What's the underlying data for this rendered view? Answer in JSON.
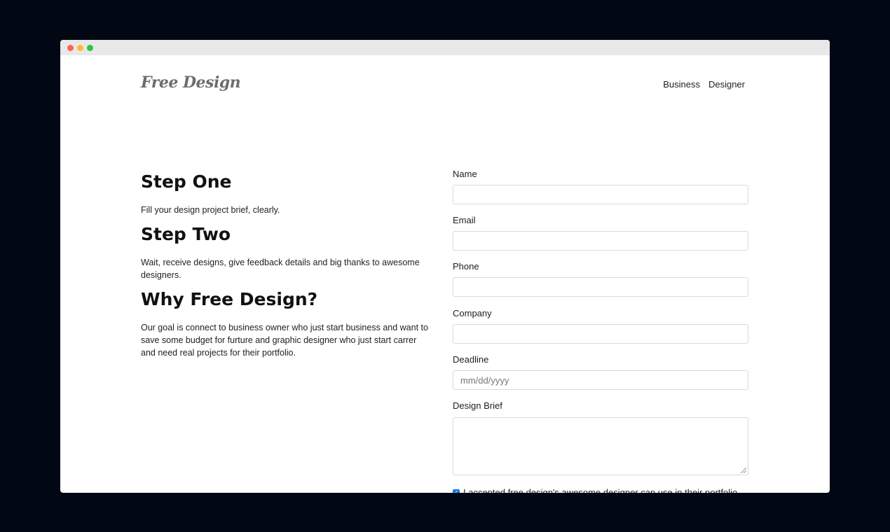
{
  "header": {
    "logo": "Free Design",
    "nav": [
      "Business",
      "Designer"
    ]
  },
  "steps": {
    "step_one_title": "Step One",
    "step_one_text": "Fill your design project brief, clearly.",
    "step_two_title": "Step Two",
    "step_two_text": "Wait, receive designs, give feedback details and big thanks to awesome designers.",
    "why_title": "Why Free Design?",
    "why_text": "Our goal is connect to business owner who just start business and want to save some budget for furture and graphic designer who just start carrer and need real projects for their portfolio."
  },
  "form": {
    "name_label": "Name",
    "email_label": "Email",
    "phone_label": "Phone",
    "company_label": "Company",
    "deadline_label": "Deadline",
    "deadline_placeholder": "mm/dd/yyyy",
    "brief_label": "Design Brief",
    "consent_text": "I accepted free design's awesome designer can use in their portfolio",
    "consent_checked": true
  },
  "colors": {
    "backdrop": "#020813",
    "checkbox": "#1a73e8",
    "logo": "#6d6d6d"
  }
}
